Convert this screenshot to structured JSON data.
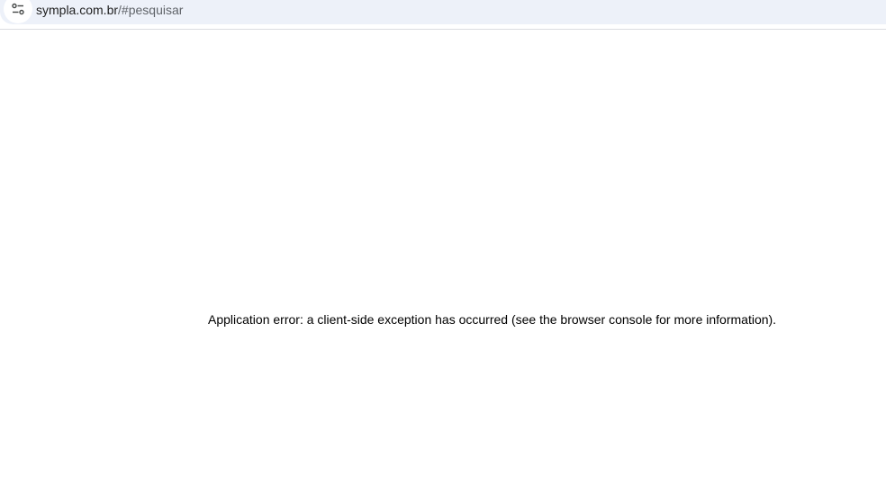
{
  "browser": {
    "address_bar": {
      "domain": "sympla.com.br",
      "path": "/#pesquisar",
      "site_info_icon": "tune-icon"
    }
  },
  "page": {
    "error_message": "Application error: a client-side exception has occurred (see the browser console for more information)."
  }
}
